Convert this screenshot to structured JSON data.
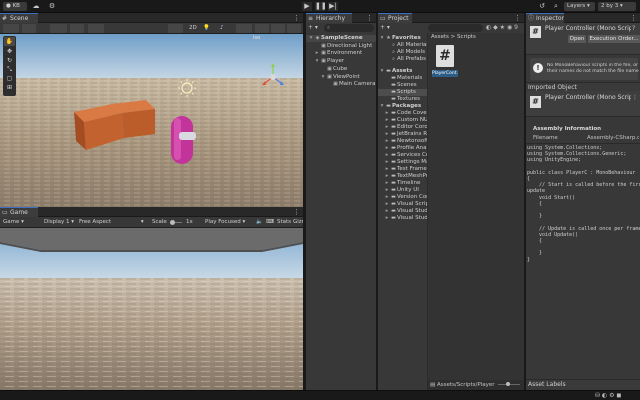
{
  "toolbar": {
    "account_label": "KB",
    "layers_label": "Layers",
    "layout_label": "2 by 3"
  },
  "scene": {
    "tab_label": "Scene",
    "mode_2d": "2D",
    "persp_label": "Iso",
    "colors": {
      "sky_top": "#6f9ec8",
      "sky_bottom": "#c9d9e6",
      "ground": "#b7a68f",
      "cube": "#c2622f",
      "capsule": "#c2349a"
    }
  },
  "game": {
    "tab_label": "Game",
    "display_mode": "Game",
    "display": "Display 1",
    "aspect": "Free Aspect",
    "scale_label": "Scale",
    "scale_value": "1x",
    "play_mode": "Play Focused",
    "stats_label": "Stats",
    "gizmos_label": "Gizmos"
  },
  "hierarchy": {
    "tab_label": "Hierarchy",
    "search_placeholder": "All",
    "items": [
      {
        "label": "SampleScene",
        "depth": 0,
        "icon": "scene-icon",
        "expanded": true
      },
      {
        "label": "Directional Light",
        "depth": 1,
        "icon": "gameobject-icon"
      },
      {
        "label": "Environment",
        "depth": 1,
        "icon": "gameobject-icon"
      },
      {
        "label": "Player",
        "depth": 1,
        "icon": "gameobject-icon",
        "expanded": true
      },
      {
        "label": "Cube",
        "depth": 2,
        "icon": "gameobject-icon"
      },
      {
        "label": "ViewPoint",
        "depth": 2,
        "icon": "gameobject-icon",
        "expanded": true
      },
      {
        "label": "Main Camera",
        "depth": 3,
        "icon": "gameobject-icon"
      }
    ]
  },
  "project": {
    "tab_label": "Project",
    "favorites_label": "Favorites",
    "favorites": [
      "All Materials",
      "All Models",
      "All Prefabs"
    ],
    "assets_label": "Assets",
    "asset_folders": [
      "Materials",
      "Scenes",
      "Scripts",
      "Textures"
    ],
    "packages_label": "Packages",
    "packages": [
      "Code Coverage",
      "Custom NUnit",
      "Editor Coroutines",
      "JetBrains Rider",
      "Newtonsoft Json",
      "Profile Analyzer",
      "Services Core",
      "Settings Manager",
      "Test Framework",
      "TextMeshPro",
      "Timeline",
      "Unity UI",
      "Version Control",
      "Visual Scripting",
      "Visual Studio",
      "Visual Studio Code"
    ],
    "breadcrumb": [
      "Assets",
      "Scripts"
    ],
    "file_name": "PlayerCont...",
    "file_icon": "#",
    "status_path": "Assets/Scripts/Player"
  },
  "inspector": {
    "tab_label": "Inspector",
    "script_title": "Player Controller (Mono Script)",
    "open_label": "Open",
    "exec_order_label": "Execution Order...",
    "warning_line1": "No MonoBehaviour scripts in the file, or",
    "warning_line2": "their names do not match the file name.",
    "imported_label": "Imported Object",
    "imported_title": "Player Controller (Mono Script)",
    "assembly_info_label": "Assembly Information",
    "filename_label": "Filename",
    "filename_value": "Assembly-CSharp.dll",
    "code_lines": [
      "using System.Collections;",
      "using System.Collections.Generic;",
      "using UnityEngine;",
      "",
      "public class PlayerC : MonoBehaviour",
      "{",
      "    // Start is called before the first frame",
      "update",
      "    void Start()",
      "    {",
      "",
      "    }",
      "",
      "    // Update is called once per frame",
      "    void Update()",
      "    {",
      "",
      "    }",
      "}"
    ],
    "asset_labels": "Asset Labels"
  }
}
